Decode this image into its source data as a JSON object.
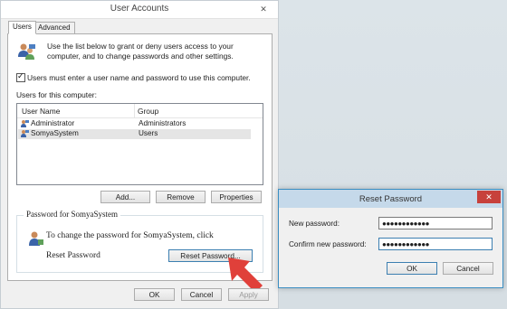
{
  "ua": {
    "title": "User Accounts",
    "close": "✕",
    "tabs": [
      "Users",
      "Advanced"
    ],
    "intro": "Use the list below to grant or deny users access to your computer, and to change passwords and other settings.",
    "checkbox_label": "Users must enter a user name and password to use this computer.",
    "checkbox_checked": true,
    "users_label": "Users for this computer:",
    "columns": [
      "User Name",
      "Group"
    ],
    "rows": [
      {
        "name": "Administrator",
        "group": "Administrators",
        "selected": false
      },
      {
        "name": "SomyaSystem",
        "group": "Users",
        "selected": true
      }
    ],
    "add_label": "Add...",
    "remove_label": "Remove",
    "properties_label": "Properties",
    "password_group_title": "Password for SomyaSystem",
    "change_text": "To change the password for SomyaSystem, click",
    "reset_text": "Reset Password",
    "reset_button": "Reset Password...",
    "ok_label": "OK",
    "cancel_label": "Cancel",
    "apply_label": "Apply"
  },
  "reset_dialog": {
    "title": "Reset Password",
    "close": "✕",
    "new_password_label": "New password:",
    "new_password_value": "●●●●●●●●●●●●",
    "confirm_label": "Confirm new password:",
    "confirm_value": "●●●●●●●●●●●●",
    "ok_label": "OK",
    "cancel_label": "Cancel"
  },
  "colors": {
    "accent": "#3c7fb1",
    "close_red": "#c7413c",
    "arrow_red": "#e0403a",
    "dialog_title_bg": "#c5d9ea"
  }
}
